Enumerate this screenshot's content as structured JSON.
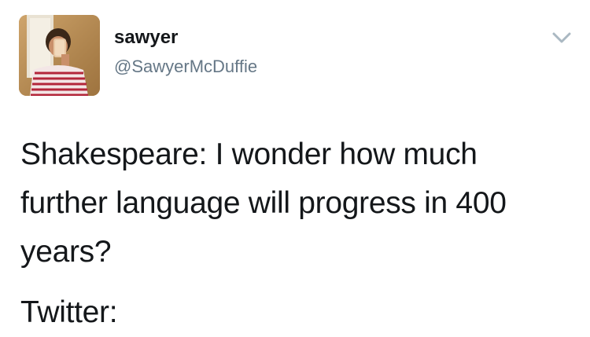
{
  "tweet": {
    "author": {
      "display_name": "sawyer",
      "handle": "@SawyerMcDuffie",
      "avatar_icon": "profile-photo"
    },
    "menu_icon": "chevron-down-icon",
    "text_line_1": "Shakespeare: I wonder how much\nfurther language will progress in 400\nyears?",
    "text_line_2": "Twitter:"
  },
  "colors": {
    "text": "#14171a",
    "secondary_text": "#657786",
    "chevron": "#aab8c2",
    "background": "#ffffff"
  }
}
